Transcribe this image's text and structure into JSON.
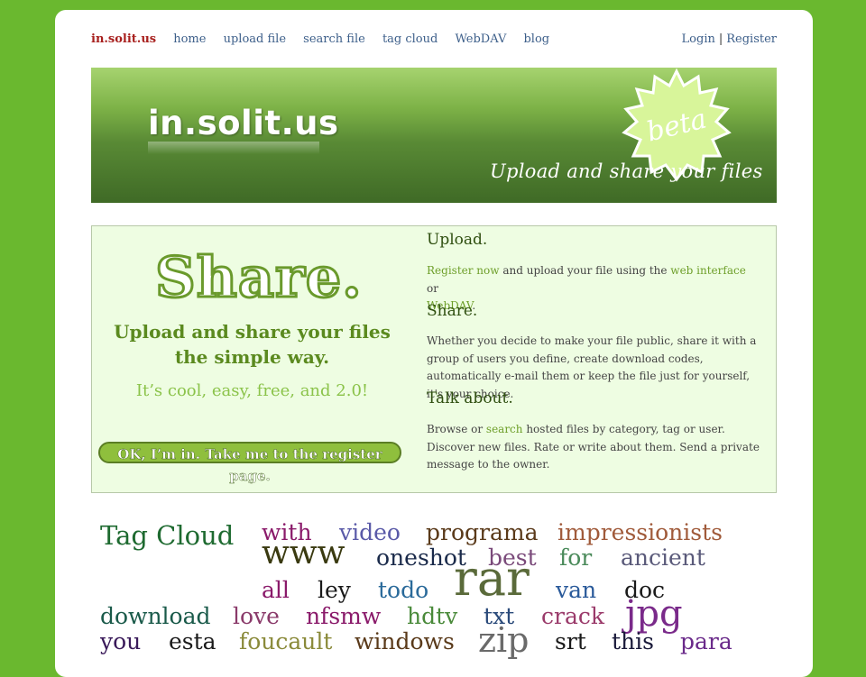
{
  "nav": {
    "brand": "in.solit.us",
    "items": [
      "home",
      "upload file",
      "search file",
      "tag cloud",
      "WebDAV",
      "blog"
    ],
    "login": "Login",
    "separator": "|",
    "register": "Register"
  },
  "banner": {
    "logo": "in.solit.us",
    "badge": "beta",
    "tagline": "Upload and share your files"
  },
  "promo": {
    "headline": "Share.",
    "subline_1": "Upload and share your files",
    "subline_2": "the simple way.",
    "cool": "It’s cool, easy, free, and 2.0!",
    "register_button": "OK, I’m in. Take me to the register page."
  },
  "sections": {
    "upload": {
      "title": "Upload.",
      "link_register": "Register now",
      "text_1": " and upload your file using the ",
      "link_web": "web interface",
      "text_2": " or",
      "link_webdav": "WebDAV",
      "text_3": "."
    },
    "share": {
      "title": "Share.",
      "text": "Whether you decide to make your file public, share it with a group of users you define, create download codes, automatically e-mail them or keep the file just for yourself, it's your choice."
    },
    "talk": {
      "title": "Talk about.",
      "text_1": "Browse or ",
      "link_search": "search",
      "text_2": " hosted files by category, tag or user. Discover new files. Rate or write about them. Send a private message to the owner."
    }
  },
  "tag_cloud": {
    "title": "Tag Cloud",
    "tags": [
      {
        "text": "with",
        "color": "#8a1a6a"
      },
      {
        "text": "video",
        "color": "#5a5aa8"
      },
      {
        "text": "programa",
        "color": "#5a3a1a"
      },
      {
        "text": "impressionists",
        "color": "#a05a3a"
      },
      {
        "text": "www",
        "color": "#3a3a10"
      },
      {
        "text": "oneshot",
        "color": "#1a2a4a"
      },
      {
        "text": "best",
        "color": "#7a4a7a"
      },
      {
        "text": "for",
        "color": "#4a8a5a"
      },
      {
        "text": "ancient",
        "color": "#5a5a7a"
      },
      {
        "text": "rar",
        "color": "#5a6a3a"
      },
      {
        "text": "all",
        "color": "#8a1a6a"
      },
      {
        "text": "ley",
        "color": "#1a1a1a"
      },
      {
        "text": "todo",
        "color": "#2a6a9a"
      },
      {
        "text": "van",
        "color": "#2a5a9a"
      },
      {
        "text": "doc",
        "color": "#1a1a1a"
      },
      {
        "text": "download",
        "color": "#1a5a4a"
      },
      {
        "text": "love",
        "color": "#8a3a6a"
      },
      {
        "text": "nfsmw",
        "color": "#8a1a6a"
      },
      {
        "text": "hdtv",
        "color": "#4a8a3a"
      },
      {
        "text": "txt",
        "color": "#2a4a7a"
      },
      {
        "text": "crack",
        "color": "#9a3a6a"
      },
      {
        "text": "jpg",
        "color": "#7a2a8a"
      },
      {
        "text": "you",
        "color": "#3a1a5a"
      },
      {
        "text": "esta",
        "color": "#1a1a1a"
      },
      {
        "text": "foucault",
        "color": "#8a8a3a"
      },
      {
        "text": "windows",
        "color": "#5a3a1a"
      },
      {
        "text": "zip",
        "color": "#6a6a6a"
      },
      {
        "text": "srt",
        "color": "#1a1a1a"
      },
      {
        "text": "this",
        "color": "#1a1a3a"
      },
      {
        "text": "para",
        "color": "#6a2a8a"
      }
    ]
  }
}
